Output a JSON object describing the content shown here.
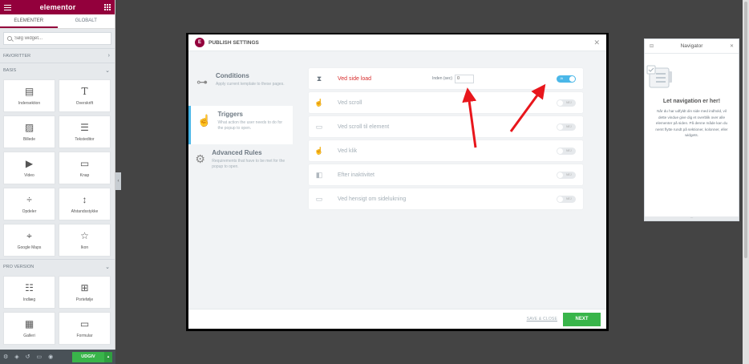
{
  "panel": {
    "logo": "elementor",
    "tabs": [
      "ELEMENTER",
      "GLOBALT"
    ],
    "search_placeholder": "Søg widget...",
    "sections": {
      "favorites": "FAVORITTER",
      "basic": "BASIS",
      "pro": "PRO VERSION"
    },
    "basic_widgets": [
      {
        "label": "Indersektion",
        "icon": "inner-section-icon"
      },
      {
        "label": "Overskrift",
        "icon": "heading-icon"
      },
      {
        "label": "Billede",
        "icon": "image-icon"
      },
      {
        "label": "Teksteditor",
        "icon": "text-editor-icon"
      },
      {
        "label": "Video",
        "icon": "video-icon"
      },
      {
        "label": "Knap",
        "icon": "button-icon"
      },
      {
        "label": "Opdeler",
        "icon": "divider-icon"
      },
      {
        "label": "Afstandsstykke",
        "icon": "spacer-icon"
      },
      {
        "label": "Google Maps",
        "icon": "map-icon"
      },
      {
        "label": "Ikon",
        "icon": "star-icon"
      }
    ],
    "pro_widgets": [
      {
        "label": "Indlæg",
        "icon": "posts-icon"
      },
      {
        "label": "Portefølje",
        "icon": "portfolio-icon"
      },
      {
        "label": "Galleri",
        "icon": "gallery-icon"
      },
      {
        "label": "Formular",
        "icon": "form-icon"
      }
    ],
    "publish_label": "UDGIV"
  },
  "modal": {
    "title": "PUBLISH SETTINGS",
    "sidebar": [
      {
        "title": "Conditions",
        "desc": "Apply current template to these pages."
      },
      {
        "title": "Triggers",
        "desc": "What action the user needs to do for the popup to open."
      },
      {
        "title": "Advanced Rules",
        "desc": "Requirements that have to be met for the popup to open."
      }
    ],
    "triggers": [
      {
        "label": "Ved side load",
        "enabled": true,
        "delay_label": "Inden (sec)",
        "delay_value": "0"
      },
      {
        "label": "Ved scroll",
        "enabled": false
      },
      {
        "label": "Ved scroll til element",
        "enabled": false
      },
      {
        "label": "Ved klik",
        "enabled": false
      },
      {
        "label": "Efter inaktivitet",
        "enabled": false
      },
      {
        "label": "Ved hensigt om sidelukning",
        "enabled": false
      }
    ],
    "toggle_on_text": "JA",
    "toggle_off_text": "NEJ",
    "save_close": "SAVE & CLOSE",
    "next": "NEXT"
  },
  "navigator": {
    "title": "Navigator",
    "heading": "Let navigation er her!",
    "body": "Når du har udfyldt din side med indhold, vil dette vindue give dig et overblik over alle elementer på siden. På denne måde kan du nemt flytte rundt på sektioner, kolonner, eller widgets."
  },
  "colors": {
    "brand": "#93003c",
    "accent": "#4ab7e8",
    "primary_button": "#39b54a",
    "annotation": "#e8161c"
  }
}
